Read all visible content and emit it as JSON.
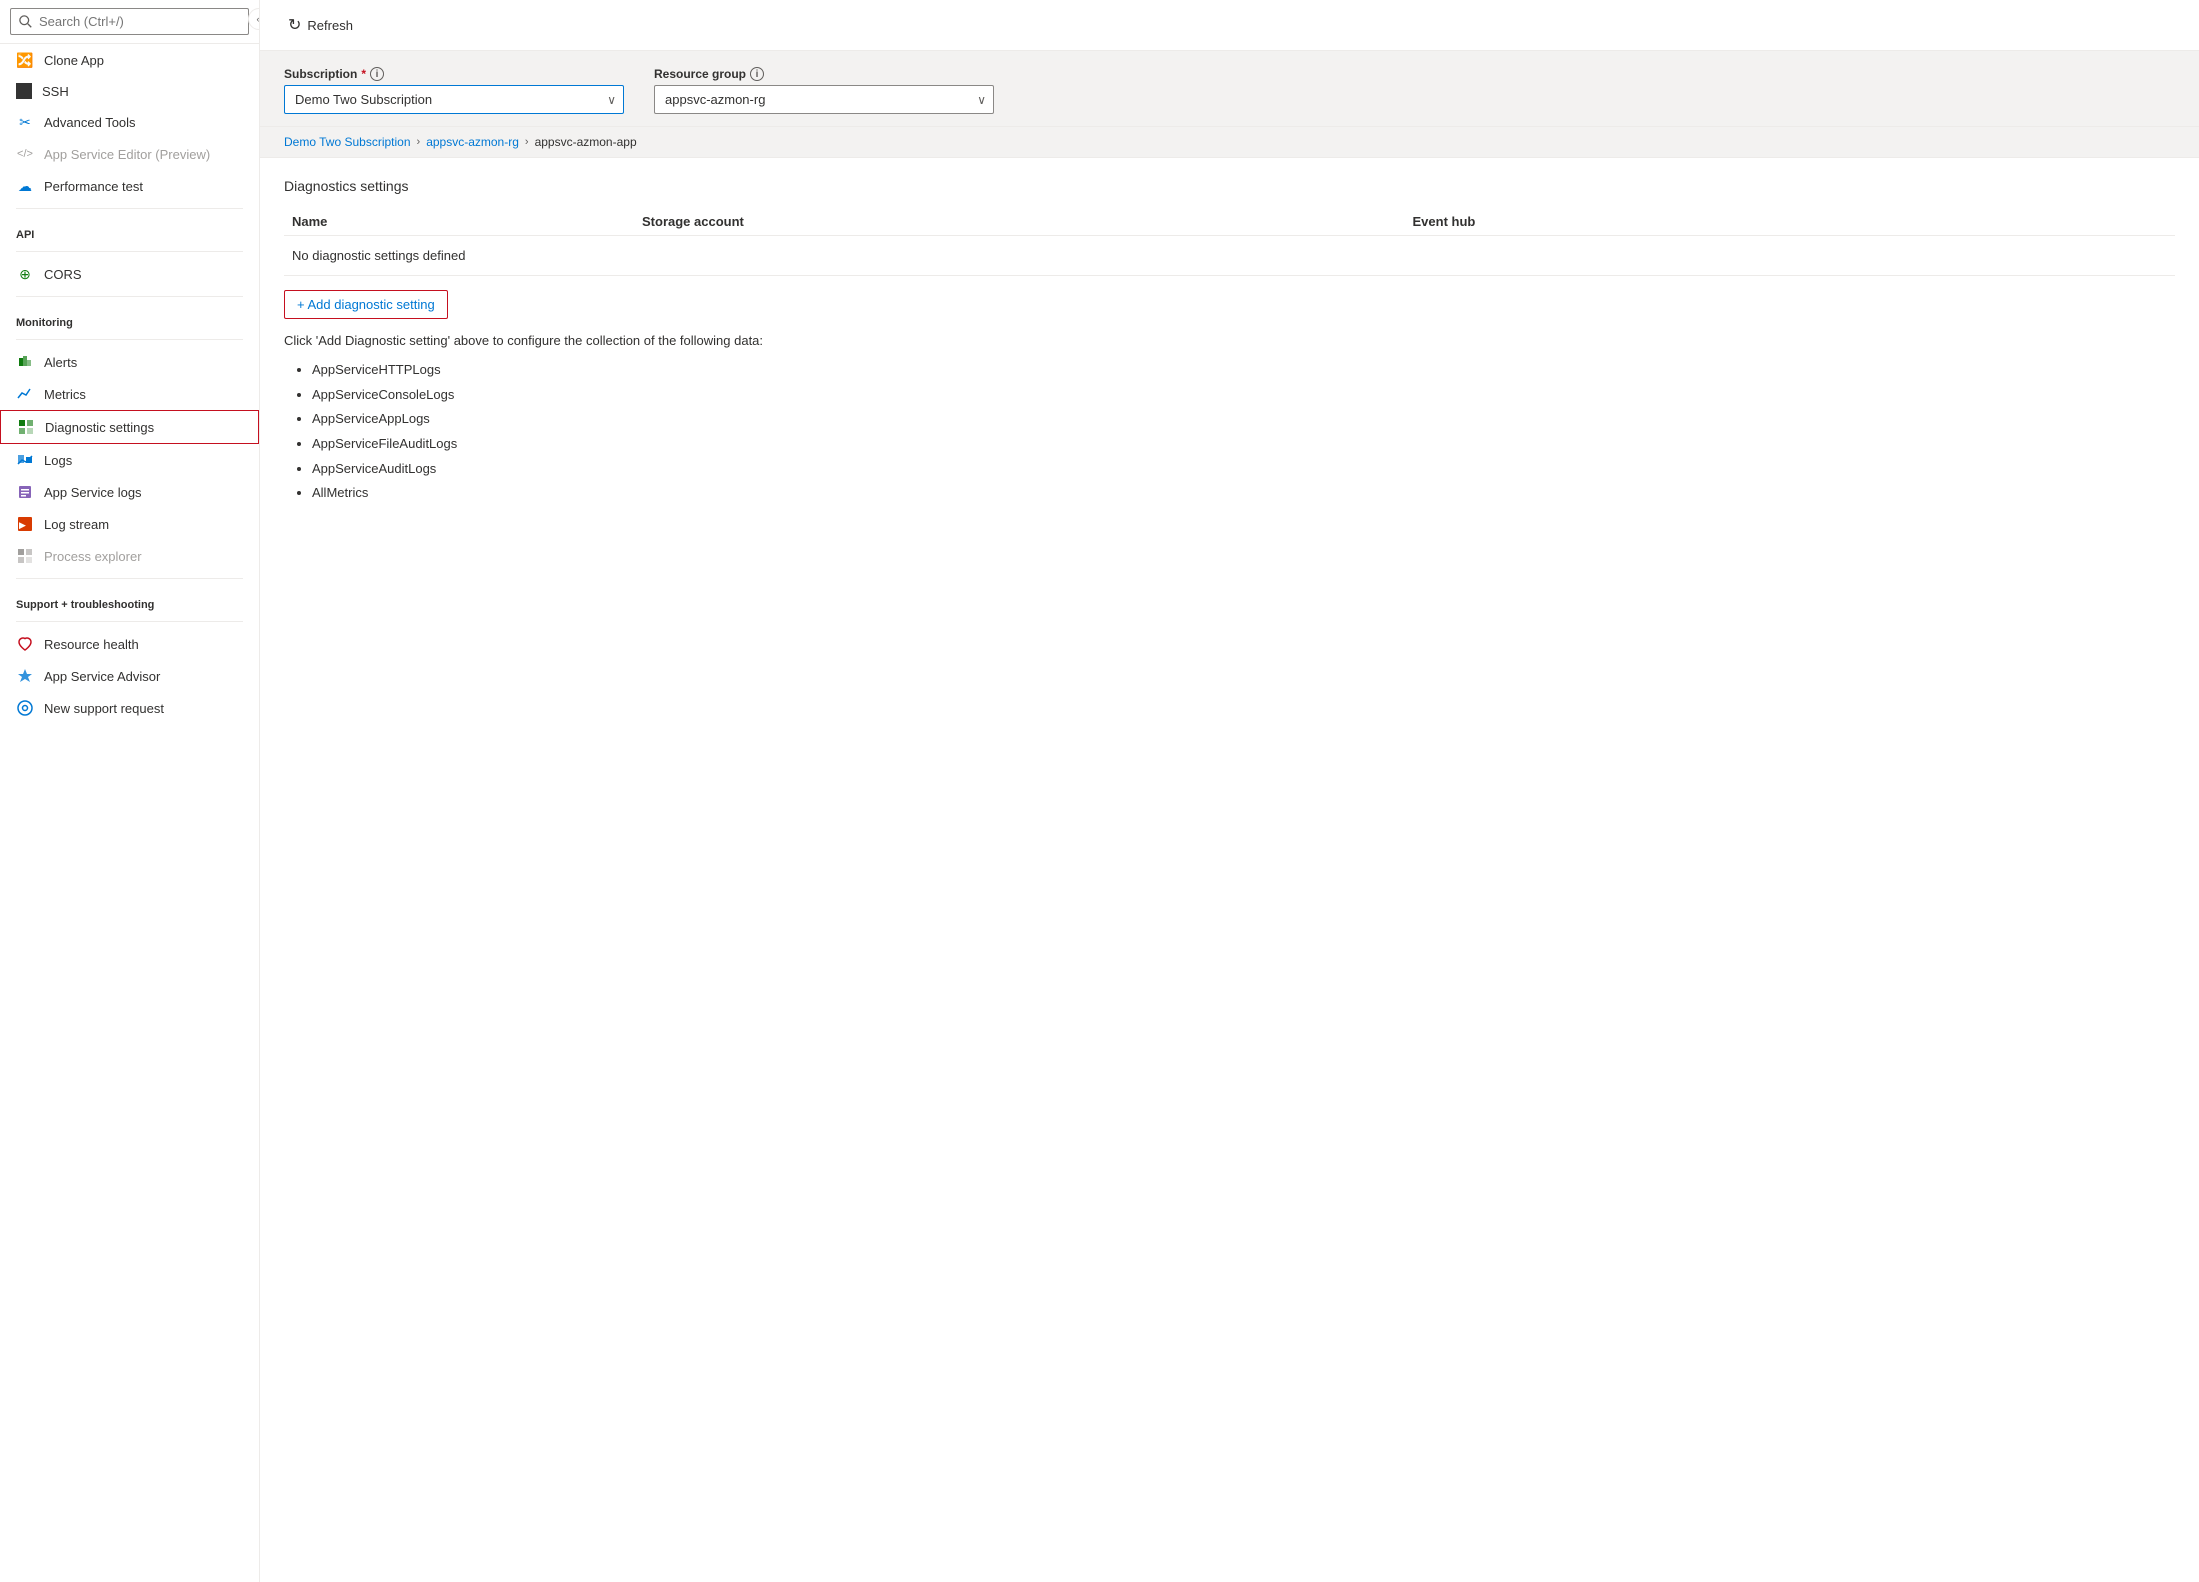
{
  "sidebar": {
    "search_placeholder": "Search (Ctrl+/)",
    "sections": [
      {
        "items": [
          {
            "id": "clone-app",
            "label": "Clone App",
            "icon": "🔀",
            "icon_color": "icon-teal",
            "disabled": false
          },
          {
            "id": "ssh",
            "label": "SSH",
            "icon": "⬛",
            "icon_color": "",
            "disabled": false
          },
          {
            "id": "advanced-tools",
            "label": "Advanced Tools",
            "icon": "✂",
            "icon_color": "icon-blue",
            "disabled": false
          },
          {
            "id": "app-service-editor",
            "label": "App Service Editor (Preview)",
            "icon": "</>",
            "icon_color": "icon-gray",
            "disabled": true
          },
          {
            "id": "performance-test",
            "label": "Performance test",
            "icon": "☁",
            "icon_color": "icon-blue",
            "disabled": false
          }
        ]
      },
      {
        "label": "API",
        "items": [
          {
            "id": "cors",
            "label": "CORS",
            "icon": "⊕",
            "icon_color": "icon-green",
            "disabled": false
          }
        ]
      },
      {
        "label": "Monitoring",
        "items": [
          {
            "id": "alerts",
            "label": "Alerts",
            "icon": "📊",
            "icon_color": "icon-green",
            "disabled": false
          },
          {
            "id": "metrics",
            "label": "Metrics",
            "icon": "📈",
            "icon_color": "icon-blue",
            "disabled": false
          },
          {
            "id": "diagnostic-settings",
            "label": "Diagnostic settings",
            "icon": "▦",
            "icon_color": "icon-green",
            "disabled": false,
            "active": true
          },
          {
            "id": "logs",
            "label": "Logs",
            "icon": "📉",
            "icon_color": "icon-blue",
            "disabled": false
          },
          {
            "id": "app-service-logs",
            "label": "App Service logs",
            "icon": "📋",
            "icon_color": "icon-purple",
            "disabled": false
          },
          {
            "id": "log-stream",
            "label": "Log stream",
            "icon": "⟹",
            "icon_color": "icon-orange",
            "disabled": false
          },
          {
            "id": "process-explorer",
            "label": "Process explorer",
            "icon": "▦",
            "icon_color": "icon-gray",
            "disabled": true
          }
        ]
      },
      {
        "label": "Support + troubleshooting",
        "items": [
          {
            "id": "resource-health",
            "label": "Resource health",
            "icon": "♡",
            "icon_color": "icon-red",
            "disabled": false
          },
          {
            "id": "app-service-advisor",
            "label": "App Service Advisor",
            "icon": "🏅",
            "icon_color": "icon-blue",
            "disabled": false
          },
          {
            "id": "new-support-request",
            "label": "New support request",
            "icon": "⊙",
            "icon_color": "icon-blue",
            "disabled": false
          }
        ]
      }
    ]
  },
  "toolbar": {
    "refresh_label": "Refresh"
  },
  "subscription_field": {
    "label": "Subscription",
    "required": true,
    "info_title": "Subscription info",
    "value": "Demo Two Subscription"
  },
  "resource_group_field": {
    "label": "Resource group",
    "info_title": "Resource group info",
    "value": "appsvc-azmon-rg"
  },
  "breadcrumb": {
    "items": [
      {
        "label": "Demo Two Subscription",
        "link": true
      },
      {
        "label": "appsvc-azmon-rg",
        "link": true
      },
      {
        "label": "appsvc-azmon-app",
        "link": false
      }
    ]
  },
  "diagnostic_settings": {
    "section_title": "Diagnostics settings",
    "table": {
      "columns": [
        "Name",
        "Storage account",
        "Event hub"
      ],
      "empty_message": "No diagnostic settings defined"
    },
    "add_button_label": "+ Add diagnostic setting",
    "info_text": "Click 'Add Diagnostic setting' above to configure the collection of the following data:",
    "data_types": [
      "AppServiceHTTPLogs",
      "AppServiceConsoleLogs",
      "AppServiceAppLogs",
      "AppServiceFileAuditLogs",
      "AppServiceAuditLogs",
      "AllMetrics"
    ]
  },
  "icons": {
    "refresh": "↻",
    "chevron_down": "∨",
    "collapse": "«",
    "info": "i",
    "search": "🔍"
  }
}
